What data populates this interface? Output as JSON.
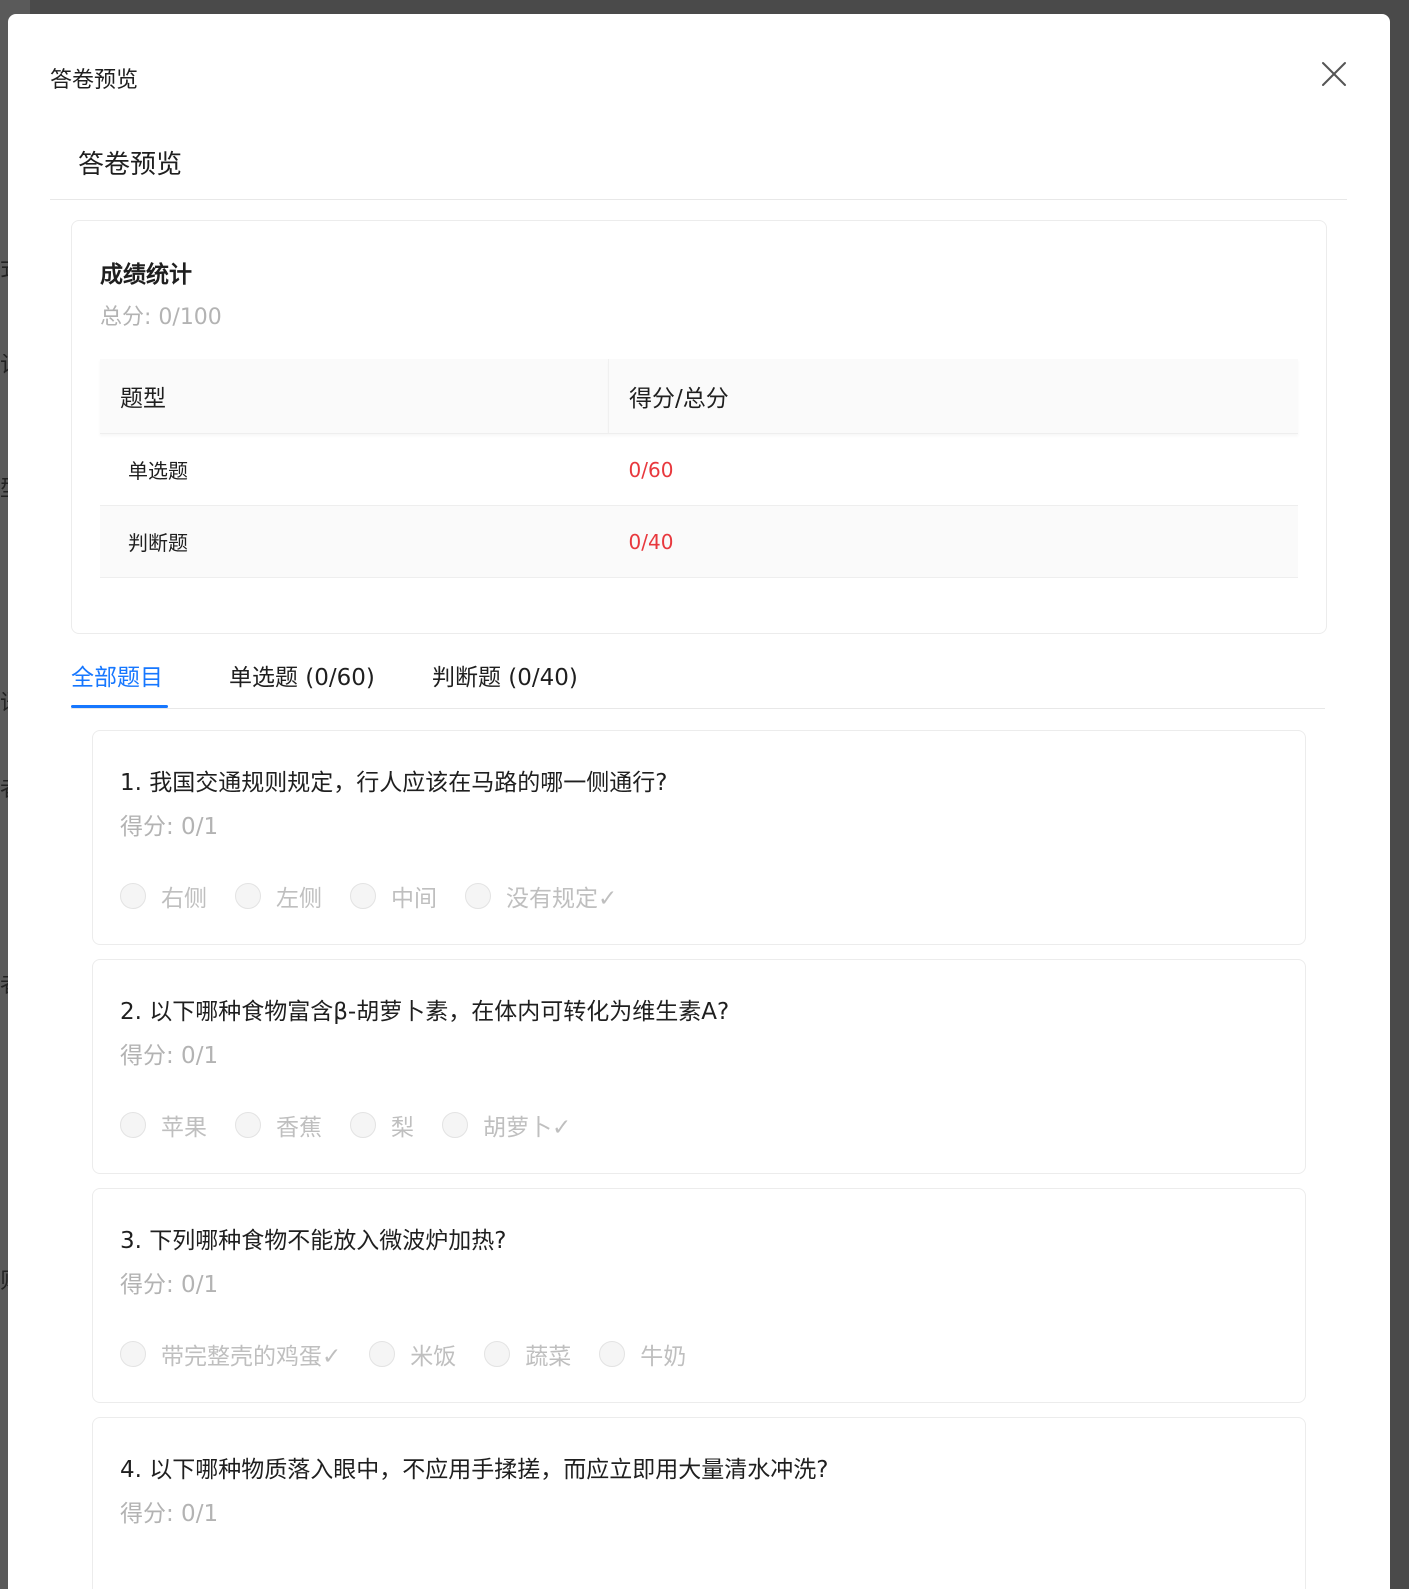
{
  "modal": {
    "title": "答卷预览"
  },
  "page": {
    "title": "答卷预览"
  },
  "stats": {
    "title": "成绩统计",
    "total": "总分: 0/100",
    "columns": [
      "题型",
      "得分/总分"
    ],
    "rows": [
      {
        "type": "单选题",
        "score": "0/60"
      },
      {
        "type": "判断题",
        "score": "0/40"
      }
    ],
    "score_color": "#e8383d"
  },
  "tabs": {
    "items": [
      {
        "label": "全部题目",
        "active": true
      },
      {
        "label": "单选题 (0/60)",
        "active": false
      },
      {
        "label": "判断题 (0/40)",
        "active": false
      }
    ],
    "accent": "#1677ff"
  },
  "questions": [
    {
      "title": "1. 我国交通规则规定，行人应该在马路的哪一侧通行?",
      "score": "得分: 0/1",
      "options": [
        "右侧",
        "左侧",
        "中间",
        "没有规定✓"
      ]
    },
    {
      "title": "2. 以下哪种食物富含β-胡萝卜素，在体内可转化为维生素A?",
      "score": "得分: 0/1",
      "options": [
        "苹果",
        "香蕉",
        "梨",
        "胡萝卜✓"
      ]
    },
    {
      "title": "3. 下列哪种食物不能放入微波炉加热?",
      "score": "得分: 0/1",
      "options": [
        "带完整壳的鸡蛋✓",
        "米饭",
        "蔬菜",
        "牛奶"
      ]
    },
    {
      "title": "4. 以下哪种物质落入眼中，不应用手揉搓，而应立即用大量清水冲洗?",
      "score": "得分: 0/1",
      "options": []
    }
  ],
  "background_fragments": [
    "式",
    "计",
    "型",
    "语",
    "者",
    "者",
    "则"
  ],
  "icons": {
    "close": "close-icon"
  }
}
